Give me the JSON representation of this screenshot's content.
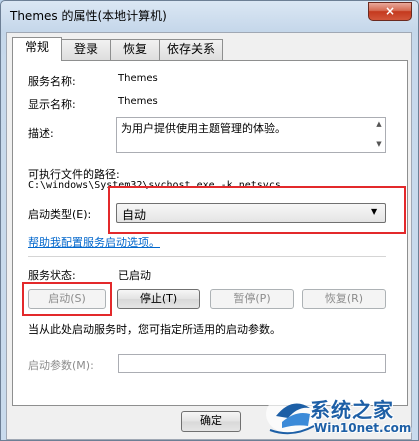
{
  "window": {
    "title": "Themes 的属性(本地计算机)",
    "close": "×"
  },
  "tabs": [
    {
      "label": "常规"
    },
    {
      "label": "登录"
    },
    {
      "label": "恢复"
    },
    {
      "label": "依存关系"
    }
  ],
  "general": {
    "service_name_label": "服务名称:",
    "service_name_value": "Themes",
    "display_name_label": "显示名称:",
    "display_name_value": "Themes",
    "description_label": "描述:",
    "description_value": "为用户提供使用主题管理的体验。",
    "exe_path_label": "可执行文件的路径:",
    "exe_path_value": "C:\\windows\\System32\\svchost.exe -k netsvcs",
    "startup_type_label": "启动类型(E):",
    "startup_type_value": "自动",
    "help_link": "帮助我配置服务启动选项。",
    "status_label": "服务状态:",
    "status_value": "已启动",
    "buttons": {
      "start": "启动(S)",
      "stop": "停止(T)",
      "pause": "暂停(P)",
      "resume": "恢复(R)"
    },
    "hint": "当从此处启动服务时，您可指定所适用的启动参数。",
    "params_label": "启动参数(M):",
    "params_value": ""
  },
  "footer": {
    "ok_label": "确定"
  },
  "watermark": {
    "brand": "系统之家",
    "site": "Win10net.com"
  },
  "colors": {
    "highlight_box": "#e3292b",
    "link": "#0066cc",
    "disabled_text": "#8c8c8c"
  }
}
